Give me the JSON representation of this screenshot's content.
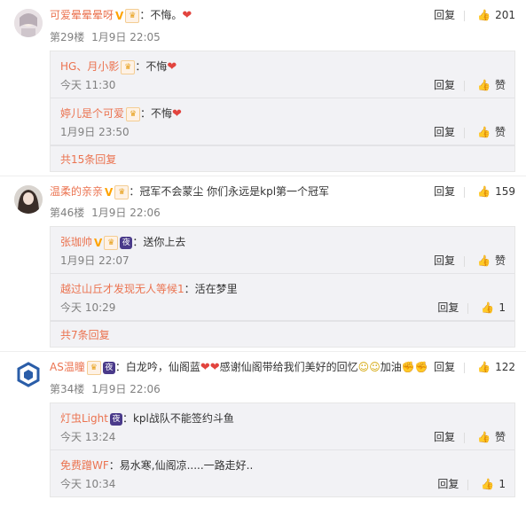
{
  "comments": [
    {
      "user": "可爱晕晕晕呀",
      "text": "：不悔。",
      "floor": "第29楼",
      "time": "1月9日 22:05",
      "reply_label": "回复",
      "likes": "201",
      "replies": [
        {
          "user": "HG、月小影",
          "text": "：不悔",
          "time": "今天 11:30",
          "reply_label": "回复",
          "likes": "赞"
        },
        {
          "user": "婷儿是个可爱",
          "text": "：不悔",
          "time": "1月9日 23:50",
          "reply_label": "回复",
          "likes": "赞"
        }
      ],
      "more": "共15条回复"
    },
    {
      "user": "温柔的亲亲",
      "text": "：冠军不会蒙尘 你们永远是kpl第一个冠军",
      "floor": "第46楼",
      "time": "1月9日 22:06",
      "reply_label": "回复",
      "likes": "159",
      "replies": [
        {
          "user": "张珈帅",
          "text": "：送你上去",
          "time": "1月9日 22:07",
          "reply_label": "回复",
          "likes": "赞"
        },
        {
          "user": "越过山丘才发现无人等候1",
          "text": "：活在梦里",
          "time": "今天 10:29",
          "reply_label": "回复",
          "likes": "1"
        }
      ],
      "more": "共7条回复"
    },
    {
      "user": "AS温瞳",
      "text_a": "：白龙吟，仙阁蓝",
      "text_b": "感谢仙阁带给我们美好的回忆",
      "text_c": "加油",
      "floor": "第34楼",
      "time": "1月9日 22:06",
      "reply_label": "回复",
      "likes": "122",
      "replies": [
        {
          "user": "灯虫Light",
          "text": "：kpl战队不能签约斗鱼",
          "time": "今天 13:24",
          "reply_label": "回复",
          "likes": "赞"
        },
        {
          "user": "免费蹭WF",
          "text": "：易水寒,仙阁凉.....一路走好..",
          "time": "今天 10:34",
          "reply_label": "回复",
          "likes": "1"
        }
      ]
    }
  ],
  "colors": {
    "username": "#eb7350",
    "reply_bg": "#f2f2f5",
    "meta": "#808080",
    "heart": "#e2443e"
  },
  "icons": {
    "like": "thumbs-up-icon",
    "vip": "vip-v-icon",
    "member": "crown-badge-icon",
    "night": "night-badge-icon",
    "heart": "heart-emoji-icon"
  },
  "badge_text": {
    "v": "V",
    "crown": "♛",
    "night": "夜"
  },
  "emoji": {
    "heart": "❤",
    "sun": "☺",
    "fist": "✊"
  }
}
